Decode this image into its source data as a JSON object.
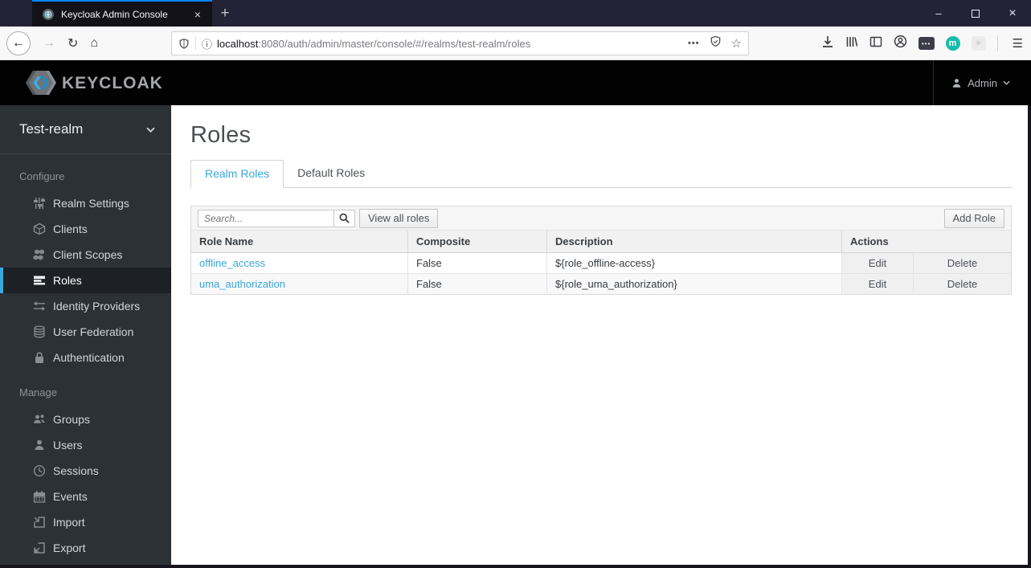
{
  "colors": {
    "accent_blue": "#39a6dc",
    "firefox_accent": "#0a84ff",
    "header_bg": "#020202",
    "sidebar_bg": "#2c3136",
    "sidebar_active_bg": "#1d2125",
    "extension_teal": "#17bcaa",
    "table_header_bg": "#f1f1f1"
  },
  "browser": {
    "tab": {
      "title": "Keycloak Admin Console",
      "favicon_icon": "keycloak-favicon",
      "close_glyph": "×"
    },
    "new_tab_glyph": "+",
    "window_controls": {
      "minimize_glyph": "–",
      "maximize_icon": "square",
      "close_glyph": "×"
    },
    "nav": {
      "back_glyph": "←",
      "forward_glyph": "→",
      "reload_glyph": "↻",
      "home_glyph": "⌂"
    },
    "urlbar": {
      "shield_icon": "tracking-protection-shield",
      "info_glyph": "ⓘ",
      "host": "localhost",
      "rest": ":8080/auth/admin/master/console/#/realms/test-realm/roles",
      "page_actions_glyph": "•••",
      "shield_check_icon": "shield-check",
      "bookmark_glyph": "☆"
    },
    "toolbar_icons": [
      "download",
      "library",
      "sidebar-toggle",
      "account"
    ],
    "extensions": [
      {
        "badge": "•••"
      },
      {
        "badge": "m"
      },
      {
        "badge": "✳"
      }
    ],
    "menu_glyph": "☰"
  },
  "header": {
    "brand": "KEYCLOAK",
    "user_label": "Admin"
  },
  "sidebar": {
    "realm": "Test-realm",
    "sections": [
      {
        "label": "Configure",
        "items": [
          {
            "label": "Realm Settings",
            "icon": "sliders",
            "active": false
          },
          {
            "label": "Clients",
            "icon": "cube",
            "active": false
          },
          {
            "label": "Client Scopes",
            "icon": "cubes",
            "active": false
          },
          {
            "label": "Roles",
            "icon": "list-rows",
            "active": true
          },
          {
            "label": "Identity Providers",
            "icon": "exchange-arrows",
            "active": false
          },
          {
            "label": "User Federation",
            "icon": "database",
            "active": false
          },
          {
            "label": "Authentication",
            "icon": "lock",
            "active": false
          }
        ]
      },
      {
        "label": "Manage",
        "items": [
          {
            "label": "Groups",
            "icon": "users",
            "active": false
          },
          {
            "label": "Users",
            "icon": "user",
            "active": false
          },
          {
            "label": "Sessions",
            "icon": "clock",
            "active": false
          },
          {
            "label": "Events",
            "icon": "calendar",
            "active": false
          },
          {
            "label": "Import",
            "icon": "import-arrow",
            "active": false
          },
          {
            "label": "Export",
            "icon": "export-arrow",
            "active": false
          }
        ]
      }
    ]
  },
  "main": {
    "title": "Roles",
    "tabs": [
      {
        "label": "Realm Roles",
        "active": true
      },
      {
        "label": "Default Roles",
        "active": false
      }
    ],
    "toolbar": {
      "search_placeholder": "Search...",
      "search_icon": "magnifier",
      "view_all_label": "View all roles",
      "add_role_label": "Add Role"
    },
    "table": {
      "columns": [
        "Role Name",
        "Composite",
        "Description",
        "Actions"
      ],
      "rows": [
        {
          "role_name": "offline_access",
          "composite": "False",
          "description": "${role_offline-access}",
          "actions": [
            "Edit",
            "Delete"
          ]
        },
        {
          "role_name": "uma_authorization",
          "composite": "False",
          "description": "${role_uma_authorization}",
          "actions": [
            "Edit",
            "Delete"
          ]
        }
      ]
    }
  }
}
